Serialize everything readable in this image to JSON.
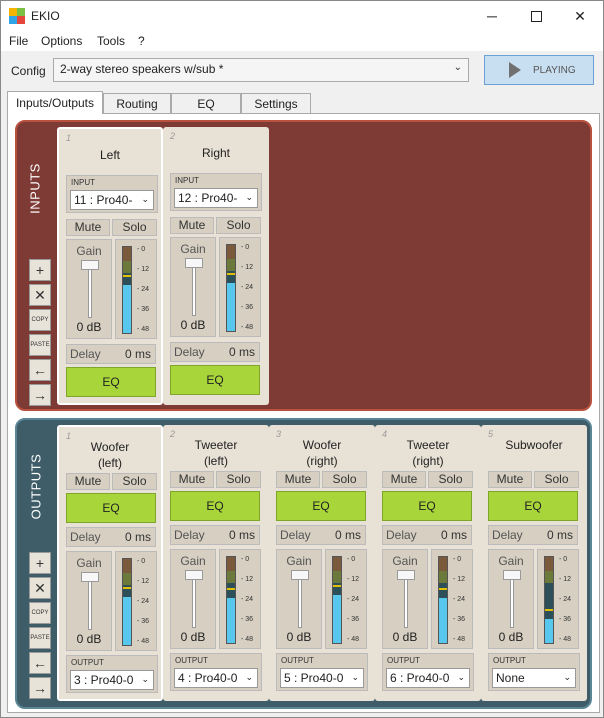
{
  "window": {
    "title": "EKIO"
  },
  "menu": [
    "File",
    "Options",
    "Tools",
    "?"
  ],
  "config": {
    "label": "Config",
    "value": "2-way stereo speakers w/sub *"
  },
  "play": {
    "label": "PLAYING"
  },
  "tabs": [
    "Inputs/Outputs",
    "Routing",
    "EQ",
    "Settings"
  ],
  "colors": {
    "inputs_bg": "#7e3a34",
    "outputs_bg": "#3e5d68",
    "eq_button": "#a8d63a",
    "meter_fill": "#58c7ee"
  },
  "side_buttons": {
    "add": "+",
    "remove": "✕",
    "copy": "COPY",
    "paste": "PASTE",
    "left": "←",
    "right": "→"
  },
  "inputs": {
    "label": "INPUTS",
    "strips": [
      {
        "num": "1",
        "name": "Left",
        "io_label": "INPUT",
        "io_value": "11 : Pro40-",
        "mute": "Mute",
        "solo": "Solo",
        "gain_label": "Gain",
        "gain_value": "0 dB",
        "delay_label": "Delay",
        "delay_value": "0 ms",
        "eq": "EQ",
        "meter_level": 0.56
      },
      {
        "num": "2",
        "name": "Right",
        "io_label": "INPUT",
        "io_value": "12 : Pro40-",
        "mute": "Mute",
        "solo": "Solo",
        "gain_label": "Gain",
        "gain_value": "0 dB",
        "delay_label": "Delay",
        "delay_value": "0 ms",
        "eq": "EQ",
        "meter_level": 0.56
      }
    ]
  },
  "outputs": {
    "label": "OUTPUTS",
    "strips": [
      {
        "num": "1",
        "name": "Woofer\n(left)",
        "io_label": "OUTPUT",
        "io_value": "3 : Pro40-0",
        "mute": "Mute",
        "solo": "Solo",
        "gain_label": "Gain",
        "gain_value": "0 dB",
        "delay_label": "Delay",
        "delay_value": "0 ms",
        "eq": "EQ",
        "meter_level": 0.56
      },
      {
        "num": "2",
        "name": "Tweeter\n(left)",
        "io_label": "OUTPUT",
        "io_value": "4 : Pro40-0",
        "mute": "Mute",
        "solo": "Solo",
        "gain_label": "Gain",
        "gain_value": "0 dB",
        "delay_label": "Delay",
        "delay_value": "0 ms",
        "eq": "EQ",
        "meter_level": 0.52
      },
      {
        "num": "3",
        "name": "Woofer\n(right)",
        "io_label": "OUTPUT",
        "io_value": "5 : Pro40-0",
        "mute": "Mute",
        "solo": "Solo",
        "gain_label": "Gain",
        "gain_value": "0 dB",
        "delay_label": "Delay",
        "delay_value": "0 ms",
        "eq": "EQ",
        "meter_level": 0.56
      },
      {
        "num": "4",
        "name": "Tweeter\n(right)",
        "io_label": "OUTPUT",
        "io_value": "6 : Pro40-0",
        "mute": "Mute",
        "solo": "Solo",
        "gain_label": "Gain",
        "gain_value": "0 dB",
        "delay_label": "Delay",
        "delay_value": "0 ms",
        "eq": "EQ",
        "meter_level": 0.52
      },
      {
        "num": "5",
        "name": "Subwoofer",
        "io_label": "OUTPUT",
        "io_value": "None",
        "mute": "Mute",
        "solo": "Solo",
        "gain_label": "Gain",
        "gain_value": "0 dB",
        "delay_label": "Delay",
        "delay_value": "0 ms",
        "eq": "EQ",
        "meter_level": 0.28
      }
    ]
  },
  "meter_ticks": [
    "0",
    "12",
    "24",
    "36",
    "48"
  ]
}
